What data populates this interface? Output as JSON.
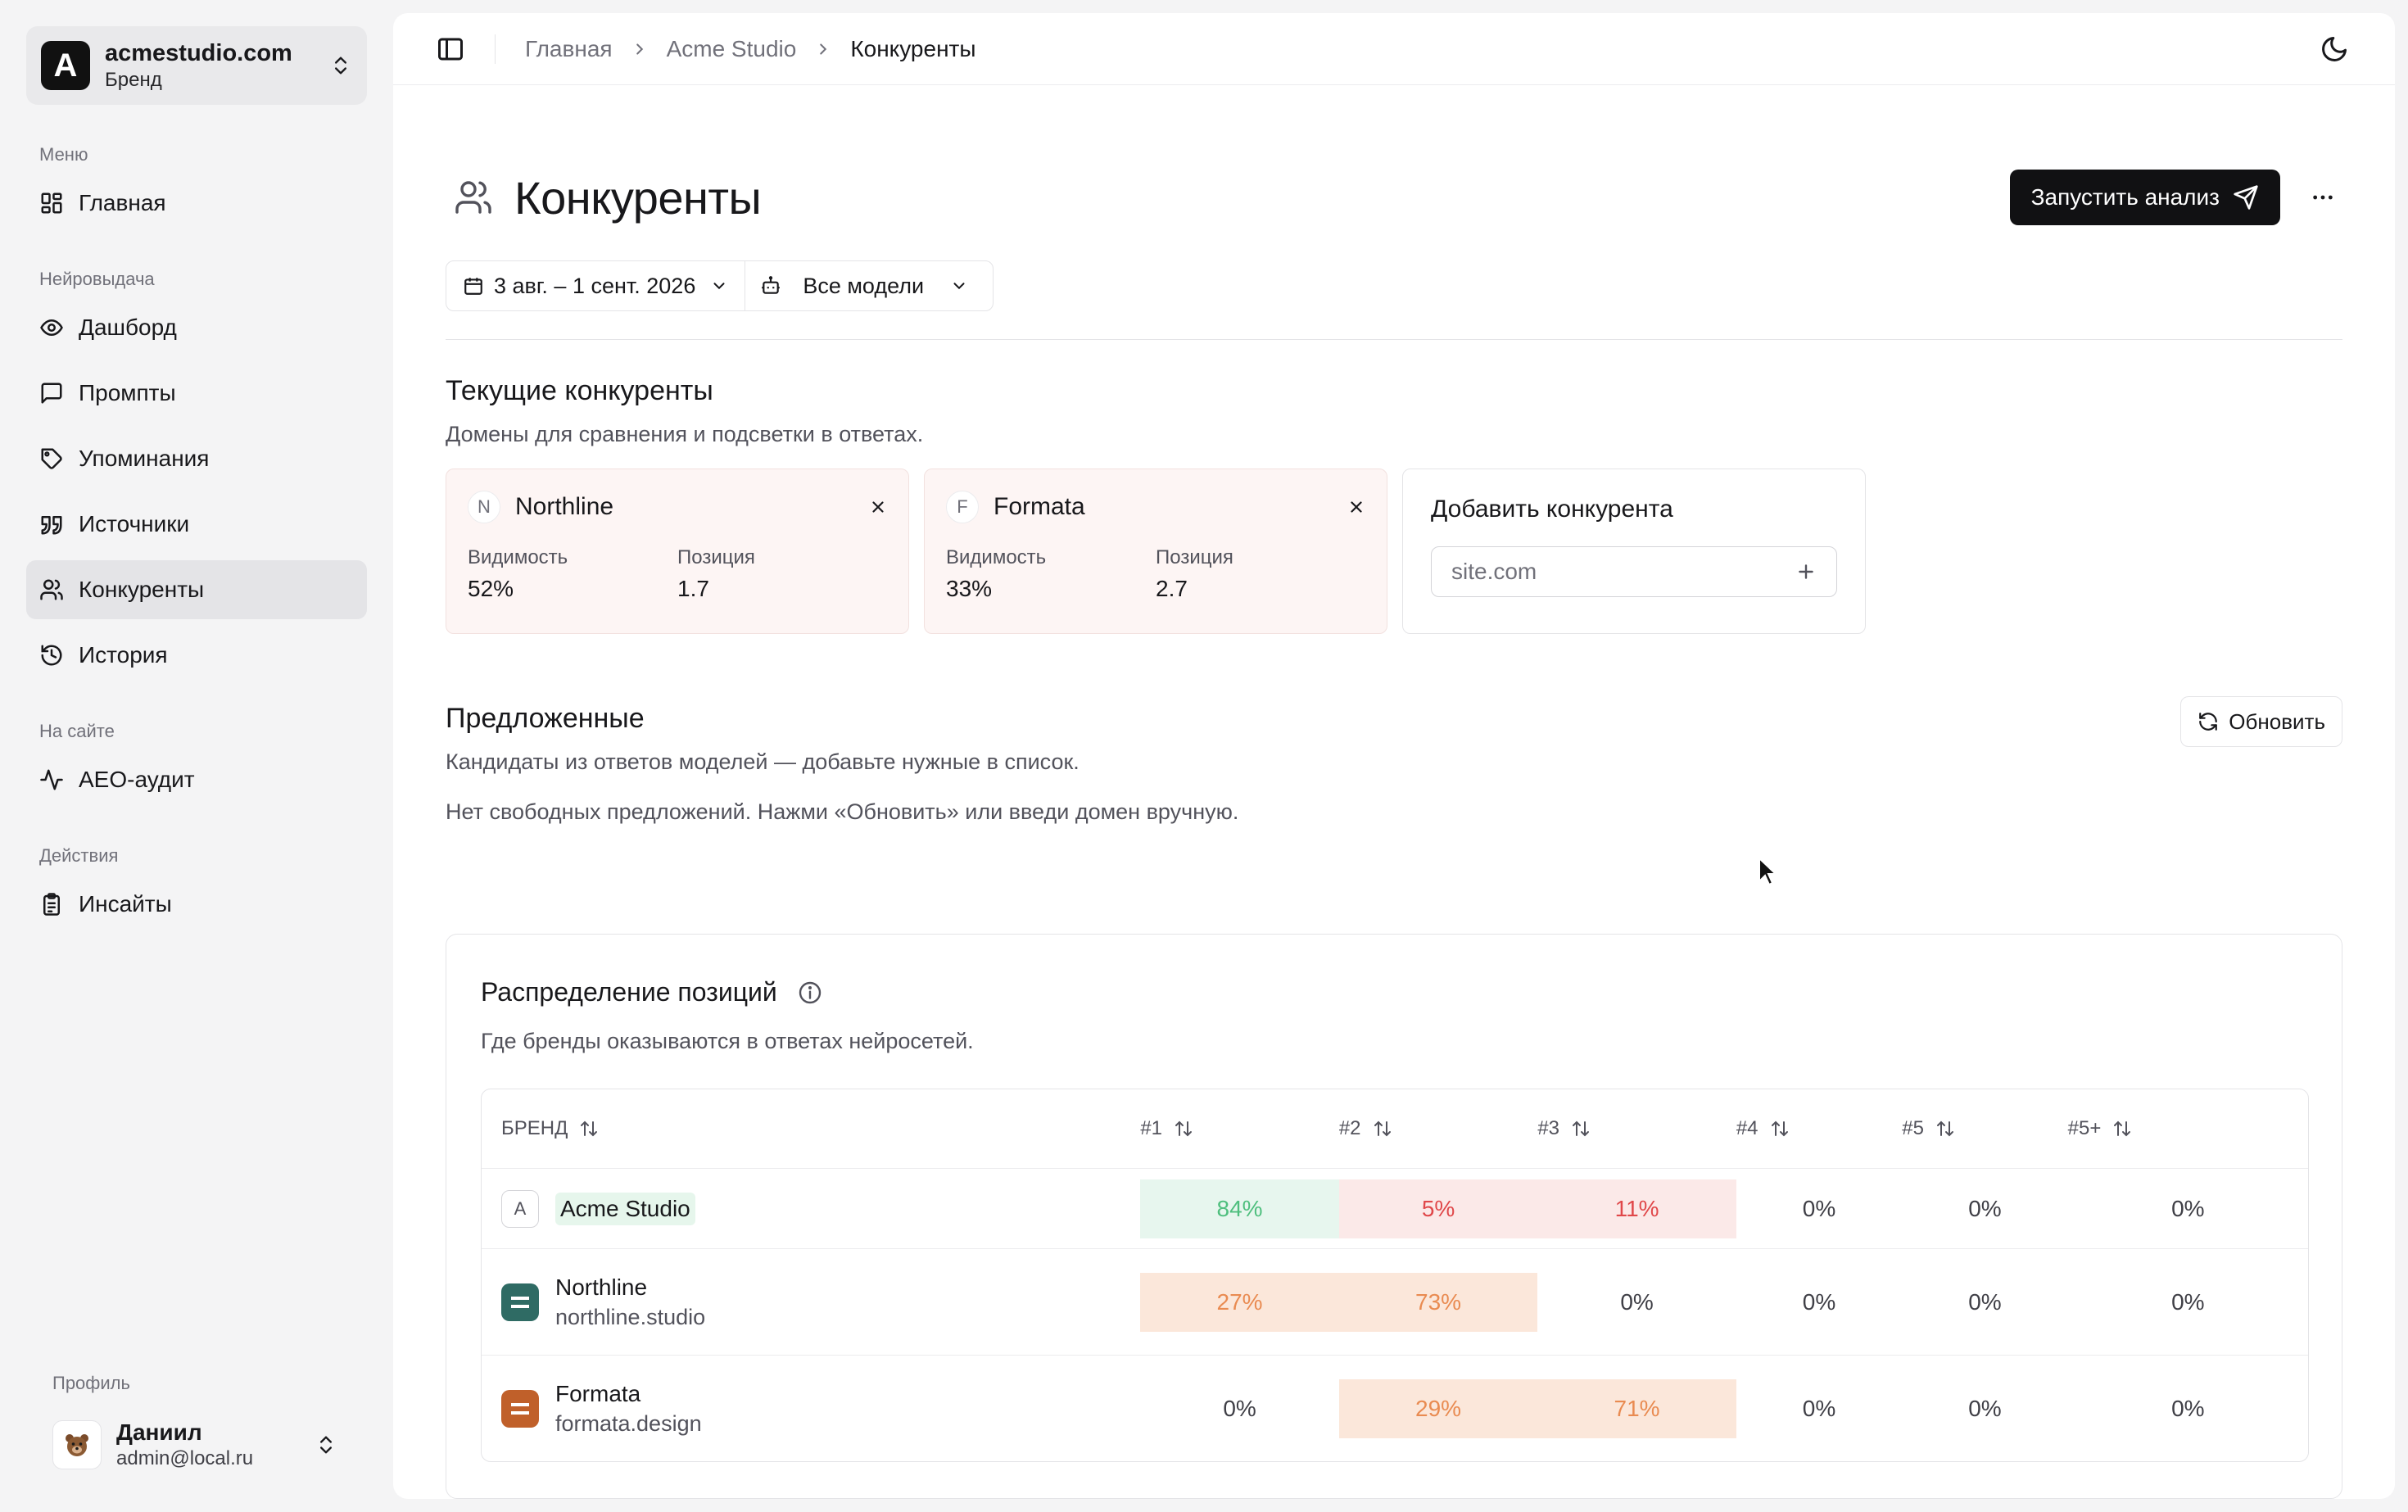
{
  "colors": {
    "accent": "#111113",
    "green_fill": "#e7f6ee",
    "green_text": "#4fbf7e",
    "red_fill": "#fbe9e8",
    "red_text": "#e0484a",
    "orange_fill": "#fbe7da",
    "orange_text": "#e98b51"
  },
  "workspace": {
    "name": "acmestudio.com",
    "sub": "Бренд",
    "logo_letter": "A"
  },
  "sidebar": {
    "groups": [
      {
        "label": "Меню",
        "items": [
          {
            "label": "Главная",
            "icon": "grid-icon"
          }
        ]
      },
      {
        "label": "Нейровыдача",
        "items": [
          {
            "label": "Дашборд",
            "icon": "eye-icon"
          },
          {
            "label": "Промпты",
            "icon": "message-square-icon"
          },
          {
            "label": "Упоминания",
            "icon": "tag-icon"
          },
          {
            "label": "Источники",
            "icon": "quote-icon"
          },
          {
            "label": "Конкуренты",
            "icon": "users-icon",
            "active": true
          },
          {
            "label": "История",
            "icon": "history-icon"
          }
        ]
      },
      {
        "label": "На сайте",
        "items": [
          {
            "label": "AEO-аудит",
            "icon": "activity-icon"
          }
        ]
      },
      {
        "label": "Действия",
        "items": [
          {
            "label": "Инсайты",
            "icon": "clipboard-icon"
          }
        ]
      }
    ],
    "profile_label": "Профиль",
    "user": {
      "name": "Даниил",
      "email": "admin@local.ru"
    }
  },
  "breadcrumb": [
    "Главная",
    "Acme Studio",
    "Конкуренты"
  ],
  "page": {
    "title": "Конкуренты",
    "run_button": "Запустить анализ",
    "date_range": "3 авг. – 1 сент. 2026",
    "models": "Все модели"
  },
  "current": {
    "title": "Текущие конкуренты",
    "subtitle": "Домены для сравнения и подсветки в ответах.",
    "visibility_label": "Видимость",
    "position_label": "Позиция",
    "cards": [
      {
        "initial": "N",
        "name": "Northline",
        "visibility": "52%",
        "position": "1.7"
      },
      {
        "initial": "F",
        "name": "Formata",
        "visibility": "33%",
        "position": "2.7"
      }
    ],
    "add": {
      "title": "Добавить конкурента",
      "placeholder": "site.com"
    }
  },
  "suggested": {
    "title": "Предложенные",
    "subtitle": "Кандидаты из ответов моделей — добавьте нужные в список.",
    "empty": "Нет свободных предложений. Нажми «Обновить» или введи домен вручную.",
    "refresh": "Обновить"
  },
  "distribution": {
    "title": "Распределение позиций",
    "subtitle": "Где бренды оказываются в ответах нейросетей.",
    "columns": [
      "Бренд",
      "#1",
      "#2",
      "#3",
      "#4",
      "#5",
      "#5+"
    ],
    "rows": [
      {
        "initial": "A",
        "name": "Acme Studio",
        "domain": "",
        "own": true,
        "cells": [
          {
            "value": "84%",
            "tone": "green"
          },
          {
            "value": "5%",
            "tone": "red"
          },
          {
            "value": "11%",
            "tone": "red"
          },
          {
            "value": "0%",
            "tone": "none"
          },
          {
            "value": "0%",
            "tone": "none"
          },
          {
            "value": "0%",
            "tone": "none"
          }
        ]
      },
      {
        "initial": "",
        "name": "Northline",
        "domain": "northline.studio",
        "own": false,
        "chip": "teal",
        "cells": [
          {
            "value": "27%",
            "tone": "orange"
          },
          {
            "value": "73%",
            "tone": "orange"
          },
          {
            "value": "0%",
            "tone": "none"
          },
          {
            "value": "0%",
            "tone": "none"
          },
          {
            "value": "0%",
            "tone": "none"
          },
          {
            "value": "0%",
            "tone": "none"
          }
        ]
      },
      {
        "initial": "",
        "name": "Formata",
        "domain": "formata.design",
        "own": false,
        "chip": "orange",
        "cells": [
          {
            "value": "0%",
            "tone": "none"
          },
          {
            "value": "29%",
            "tone": "orange"
          },
          {
            "value": "71%",
            "tone": "orange"
          },
          {
            "value": "0%",
            "tone": "none"
          },
          {
            "value": "0%",
            "tone": "none"
          },
          {
            "value": "0%",
            "tone": "none"
          }
        ]
      }
    ]
  }
}
